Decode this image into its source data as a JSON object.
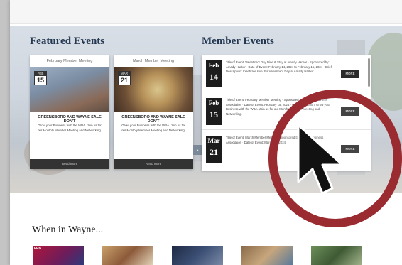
{
  "colors": {
    "accent": "#9a2b30",
    "navy": "#243852",
    "dark": "#1c1c1c"
  },
  "featured": {
    "title": "Featured Events",
    "cards": [
      {
        "header": "February Member Meeting",
        "month": "FEB",
        "day": "15",
        "title": "GREENSBORO AND WAYNE SALE DON'T",
        "desc": "Grow your Business with the WBA. Join us for our Monthly Member Meeting and Networking.",
        "button": "Read more"
      },
      {
        "header": "March Member Meeting",
        "month": "MAR",
        "day": "21",
        "title": "GREENSBORO AND WAYNE SALE DON'T",
        "desc": "Grow your Business with the WBA. Join us for our Monthly Member Meeting and Networking.",
        "button": "Read more"
      }
    ],
    "arrow": "›"
  },
  "member": {
    "title": "Member Events",
    "rows": [
      {
        "month": "Feb",
        "day": "14",
        "info": "Title of Event: Valentine's Day Dine & Stay at Amady Harbor · Sponsored by: Amady Harbor · Date of Event: February 14, 2024 to February 15, 2024 · Brief Description: Celebrate love this Valentine's Day at Amady Harbor",
        "button": "MORE"
      },
      {
        "month": "Feb",
        "day": "15",
        "info": "Title of Event: February Member Meeting · Sponsored by: Wayne Business Association · Date of Event: February 15, 2024 · Brief Description: Grow your Business with the WBA. Join us for our Monthly Member Meeting and Networking.",
        "button": "MORE"
      },
      {
        "month": "Mar",
        "day": "21",
        "info": "Title of Event: March Member Meeting · Sponsored by: Wayne Business Association · Date of Event: March 21, 2024",
        "button": "MORE"
      }
    ]
  },
  "wayne": {
    "title": "When in Wayne...",
    "thumbs": [
      {
        "label": "FEB"
      },
      {
        "label": ""
      },
      {
        "label": ""
      },
      {
        "label": ""
      },
      {
        "label": ""
      }
    ]
  }
}
